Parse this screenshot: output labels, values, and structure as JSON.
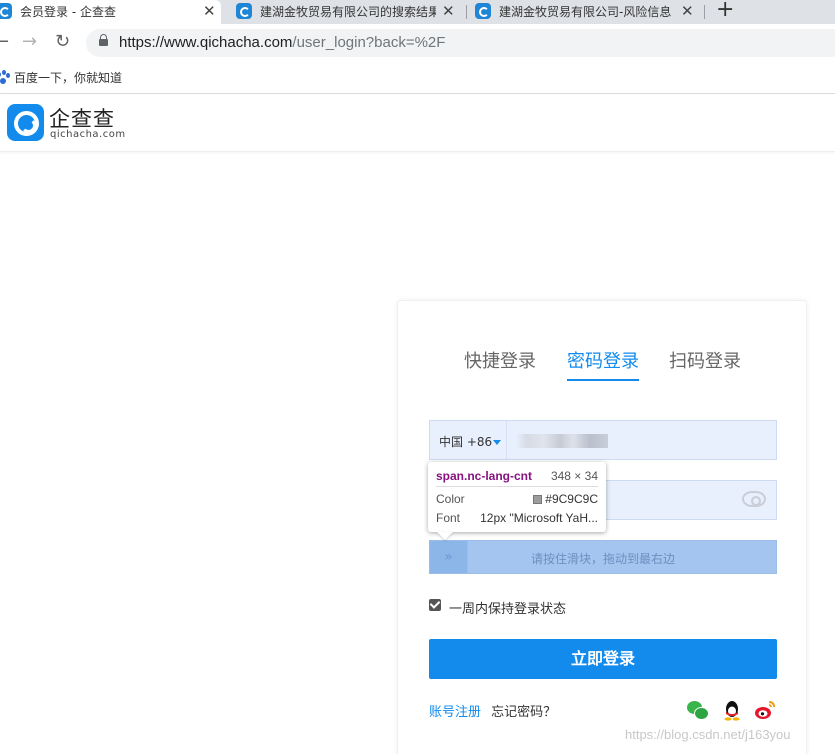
{
  "browser": {
    "tabs": [
      {
        "title": "会员登录 - 企查查",
        "active": true
      },
      {
        "title": "建湖金牧贸易有限公司的搜索结果",
        "active": false
      },
      {
        "title": "建湖金牧贸易有限公司-风险信息",
        "active": false
      }
    ],
    "close_glyph": "✕",
    "new_tab_glyph": "+",
    "url_host": "https://www.qichacha.com",
    "url_path": "/user_login?back=%2F",
    "bookmark_label": "百度一下，你就知道"
  },
  "site": {
    "logo_name": "企查查",
    "logo_sub": "qichacha.com"
  },
  "login": {
    "tabs": [
      "快捷登录",
      "密码登录",
      "扫码登录"
    ],
    "country_code": "中国 +86",
    "slider_hint": "请按住滑块，拖动到最右边",
    "slider_handle": "»",
    "remember_label": "一周内保持登录状态",
    "login_button": "立即登录",
    "register_link": "账号注册",
    "forgot_link": "忘记密码？"
  },
  "devtools_tooltip": {
    "selector": "span.nc-lang-cnt",
    "dimensions": "348 × 34",
    "color_label": "Color",
    "color_value": "#9C9C9C",
    "font_label": "Font",
    "font_value": "12px \"Microsoft YaH..."
  },
  "watermark": "https://blog.csdn.net/j163you",
  "colors": {
    "brand_blue": "#128BED",
    "input_bg": "#E8F0FE",
    "slider_bg": "#A3C5EF"
  }
}
